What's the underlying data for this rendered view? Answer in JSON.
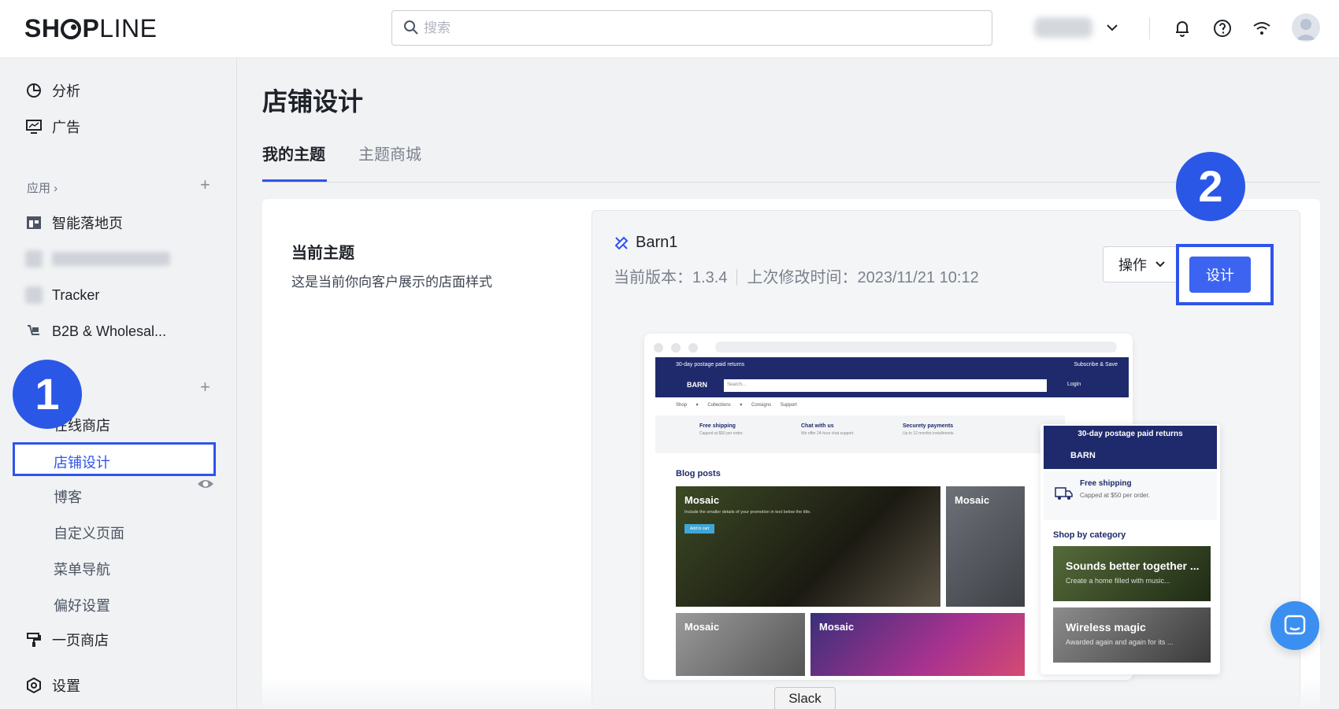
{
  "topbar": {
    "logo_bold": "SH",
    "logo_bold2": "P",
    "logo_light": "LINE",
    "search_placeholder": "搜索"
  },
  "sidebar": {
    "items": [
      {
        "label": "分析",
        "icon": "pie-chart-icon"
      },
      {
        "label": "广告",
        "icon": "monitor-icon"
      }
    ],
    "apps_section": "应用",
    "apps": [
      {
        "label": "智能落地页",
        "icon": "layout-icon"
      },
      {
        "label": "Tracker",
        "icon": "app-icon"
      },
      {
        "label": "B2B & Wholesal...",
        "icon": "cart-icon"
      }
    ],
    "online_store": "在线商店",
    "sub_items": [
      "店铺设计",
      "博客",
      "自定义页面",
      "菜单导航",
      "偏好设置"
    ],
    "one_page": "一页商店",
    "settings": "设置"
  },
  "badges": {
    "one": "1",
    "two": "2"
  },
  "main": {
    "title": "店铺设计",
    "tabs": [
      "我的主题",
      "主题商城"
    ],
    "current_theme_title": "当前主题",
    "current_theme_desc": "这是当前你向客户展示的店面样式",
    "theme": {
      "name": "Barn1",
      "version": "当前版本：1.3.4",
      "modified": "上次修改时间：2023/11/21 10:12",
      "ops_label": "操作",
      "design_label": "设计"
    }
  },
  "preview": {
    "announcement": "30-day postage paid returns",
    "subscribe": "Subscribe & Save",
    "brand": "BARN",
    "search": "Search...",
    "login": "Login",
    "menu": "Shop ▾ Collections ▾ Consigns Support",
    "features": [
      {
        "title": "Free shipping",
        "desc": "Capped at $50 per order."
      },
      {
        "title": "Chat with us",
        "desc": "We offer 24-hour chat support."
      },
      {
        "title": "Securety payments",
        "desc": "Up to 12 months installments."
      }
    ],
    "blog_title": "Blog posts",
    "tile_title": "Mosaic",
    "tile_desc": "Include the smaller details of your promotion in text below the title.",
    "tile_button": "Add to cart"
  },
  "mobile": {
    "announcement": "30-day postage paid returns",
    "brand": "BARN",
    "shipping_title": "Free shipping",
    "shipping_desc": "Capped at $50 per order.",
    "category_title": "Shop by category",
    "tile1_title": "Sounds better together ...",
    "tile1_desc": "Create a home filled with music...",
    "tile2_title": "Wireless magic",
    "tile2_desc": "Awarded again and again for its ..."
  },
  "tooltip": "Slack",
  "colors": {
    "accent": "#2f54eb",
    "navy": "#1e2a6b",
    "badge": "#2b57e6"
  }
}
